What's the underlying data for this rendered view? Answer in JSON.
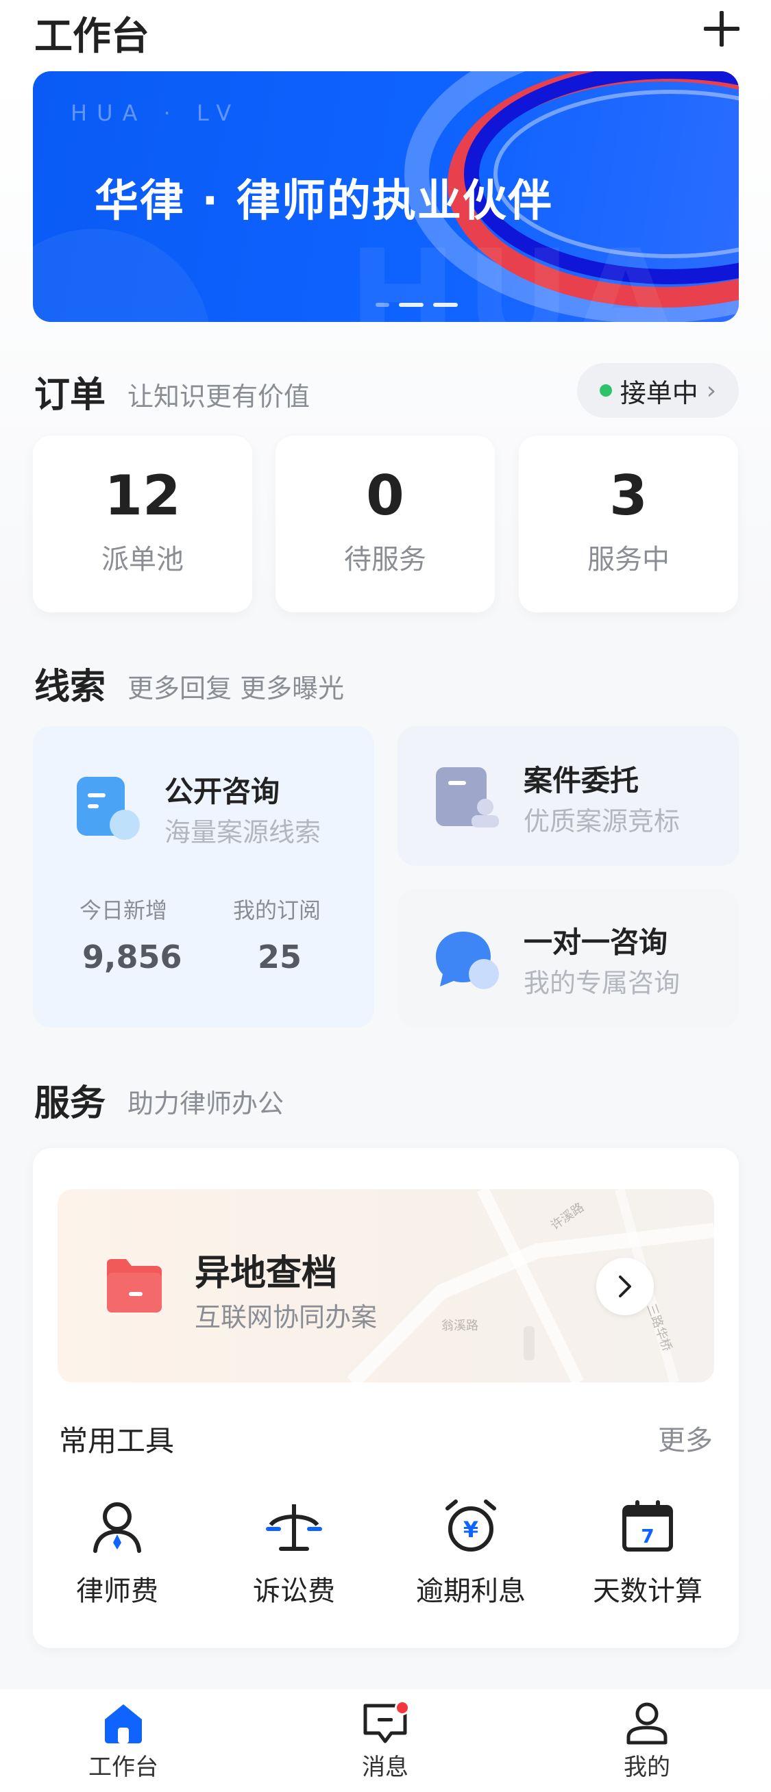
{
  "header": {
    "title": "工作台"
  },
  "banner": {
    "tag": "HUA · LV",
    "headline": "华律 · 律师的执业伙伴",
    "watermark": "HUA LV"
  },
  "orders": {
    "title": "订单",
    "subtitle": "让知识更有价值",
    "status_label": "接单中",
    "status_color": "#2ec36a",
    "stats": [
      {
        "value": "12",
        "label": "派单池"
      },
      {
        "value": "0",
        "label": "待服务"
      },
      {
        "value": "3",
        "label": "服务中"
      }
    ]
  },
  "clues": {
    "title": "线索",
    "subtitle": "更多回复 更多曝光",
    "public": {
      "title": "公开咨询",
      "subtitle": "海量案源线索",
      "today_label": "今日新增",
      "today_value": "9,856",
      "sub_label": "我的订阅",
      "sub_value": "25"
    },
    "entrust": {
      "title": "案件委托",
      "subtitle": "优质案源竞标"
    },
    "one_on_one": {
      "title": "一对一咨询",
      "subtitle": "我的专属咨询"
    }
  },
  "service": {
    "title": "服务",
    "subtitle": "助力律师办公",
    "remote": {
      "title": "异地查档",
      "subtitle": "互联网协同办案",
      "map_labels": [
        "许溪路",
        "翁溪路",
        "三路华桥"
      ]
    },
    "tools_title": "常用工具",
    "tools_more": "更多",
    "tools": [
      {
        "label": "律师费",
        "icon": "lawyer-icon"
      },
      {
        "label": "诉讼费",
        "icon": "scale-icon"
      },
      {
        "label": "逾期利息",
        "icon": "alarm-clock-icon"
      },
      {
        "label": "天数计算",
        "icon": "calendar-icon"
      }
    ],
    "calendar_day": "7"
  },
  "tabbar": {
    "items": [
      {
        "label": "工作台",
        "icon": "home-icon",
        "active": true
      },
      {
        "label": "消息",
        "icon": "message-icon",
        "badge": true
      },
      {
        "label": "我的",
        "icon": "user-icon"
      }
    ]
  },
  "colors": {
    "brand": "#0f63ff",
    "accent_red": "#f5353d",
    "muted": "#8a8d94"
  }
}
